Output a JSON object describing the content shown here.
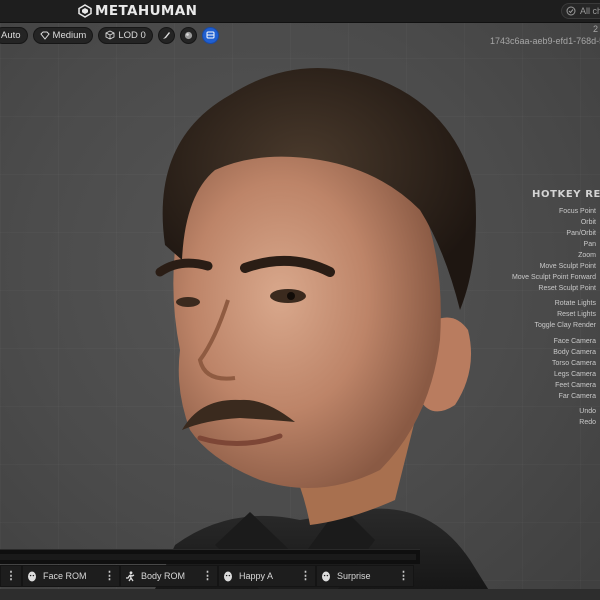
{
  "app": {
    "logo_text": "METAHUMAN",
    "filter_label": "All ch"
  },
  "toolbar": {
    "auto_label": "Auto",
    "quality_label": "Medium",
    "lod_label": "LOD 0"
  },
  "meta": {
    "number": "2",
    "id": "1743c6aa-aeb9-efd1-768d-5"
  },
  "hotkeys": {
    "title": "HOTKEY REFE",
    "items": [
      "Focus Point",
      "Orbit",
      "Pan/Orbit",
      "Pan",
      "Zoom",
      "Move Sculpt Point",
      "Move Sculpt Point Forward",
      "Reset Sculpt Point",
      "Rotate Lights",
      "Reset Lights",
      "Toggle Clay Render",
      "Face Camera",
      "Body Camera",
      "Torso Camera",
      "Legs Camera",
      "Feet Camera",
      "Far Camera",
      "Undo",
      "Redo"
    ]
  },
  "animations": [
    {
      "label": "Face ROM",
      "icon": "face-icon"
    },
    {
      "label": "Body ROM",
      "icon": "running-figure-icon"
    },
    {
      "label": "Happy A",
      "icon": "face-icon"
    },
    {
      "label": "Surprise",
      "icon": "face-icon"
    }
  ],
  "colors": {
    "accent": "#1f5fd1",
    "background": "#4a4a4a",
    "topbar": "#1e1e1e"
  }
}
